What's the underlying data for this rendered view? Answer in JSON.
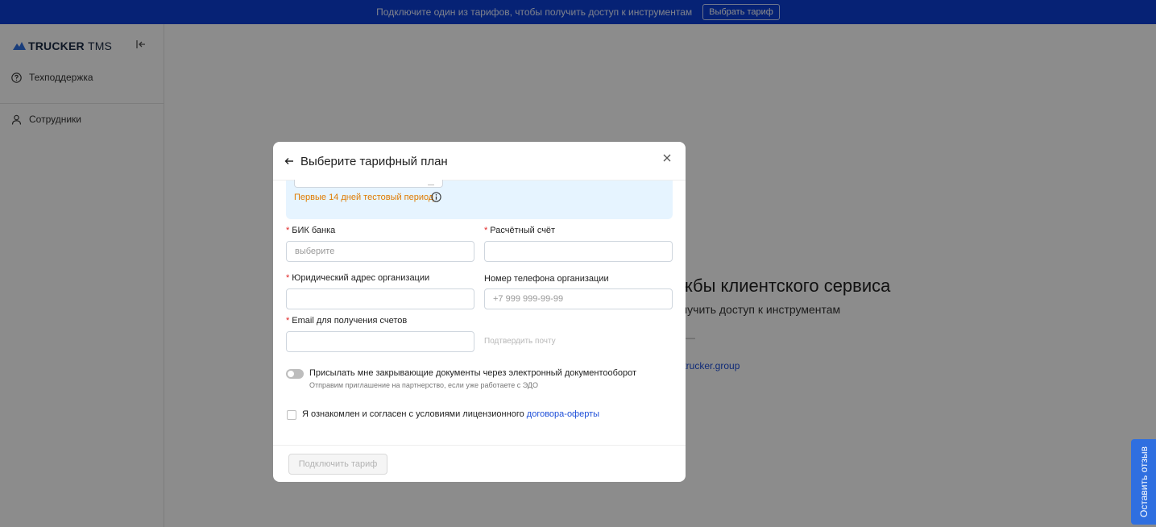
{
  "banner": {
    "text": "Подключите один из тарифов, чтобы получить доступ к инструментам",
    "button_label": "Выбрать тариф"
  },
  "sidebar": {
    "logo_bold": "TRUCKER",
    "logo_light": "TMS",
    "items": [
      {
        "label": "Техподдержка",
        "icon": "question-circle-icon"
      },
      {
        "label": "Сотрудники",
        "icon": "user-icon"
      }
    ]
  },
  "background": {
    "heading": "жбы клиентского сервиса",
    "subtitle": "лучить доступ к инструментам",
    "dash": "—",
    "link": "ttrucker.group"
  },
  "feedback_tab": {
    "label": "Оставить отзыв"
  },
  "modal": {
    "title": "Выберите тарифный план",
    "trial_text": "Первые 14 дней тестовый период",
    "fields": {
      "bik": {
        "label": "БИК банка",
        "placeholder": "выберите",
        "required": true
      },
      "account": {
        "label": "Расчётный счёт",
        "placeholder": "",
        "required": true
      },
      "legal_address": {
        "label": "Юридический адрес организации",
        "placeholder": "",
        "required": true
      },
      "phone": {
        "label": "Номер телефона организации",
        "placeholder": "+7 999 999-99-99",
        "required": false
      },
      "email": {
        "label": "Email для получения счетов",
        "placeholder": "",
        "required": true
      }
    },
    "confirm_email": "Подтвердить почту",
    "edo_toggle": {
      "label": "Присылать мне закрывающие документы через электронный документооборот",
      "hint": "Отправим приглашение на партнерство, если уже работаете с ЭДО",
      "on": false
    },
    "agreement": {
      "text": "Я ознакомлен и согласен с условиями лицензионного",
      "link": "договора-оферты",
      "checked": false
    },
    "submit_label": "Подключить тариф"
  },
  "colors": {
    "banner": "#0b3fd6",
    "accent": "#1d4ed8",
    "trial": "#e07a00",
    "required": "#e02424"
  }
}
